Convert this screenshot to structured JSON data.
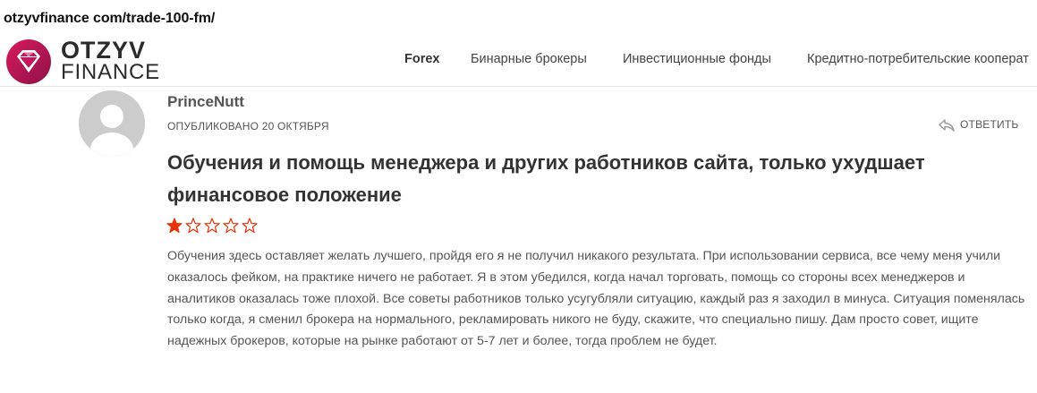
{
  "caption": {
    "url": "otzyvfinance com/trade-100-fm/"
  },
  "header": {
    "logo": {
      "line1": "OTZYV",
      "line2": "FINANCE",
      "mark": "diamond-logo-icon",
      "brand_color": "#c2185b"
    },
    "nav": [
      {
        "label": "Forex",
        "active": true
      },
      {
        "label": "Бинарные брокеры",
        "active": false
      },
      {
        "label": "Инвестиционные фонды",
        "active": false
      },
      {
        "label": "Кредитно-потребительские кооперат",
        "active": false
      }
    ]
  },
  "comment": {
    "avatar": "user-avatar-placeholder-icon",
    "author": "PrinceNutt",
    "published": "ОПУБЛИКОВАНО 20 ОКТЯБРЯ",
    "reply_label": "ОТВЕТИТЬ",
    "reply_icon": "reply-arrow-icon",
    "title": "Обучения и помощь менеджера и других работников сайта, только ухудшает финансовое положение",
    "rating": {
      "value": 1,
      "max": 5,
      "star_color": "#e8340c"
    },
    "body": "Обучения здесь оставляет желать лучшего, пройдя его я не получил никакого результата. При использовании сервиса, все чему меня учили оказалось фейком, на практике ничего не работает. Я в этом убедился, когда начал торговать, помощь со стороны всех менеджеров и аналитиков оказалась тоже плохой. Все советы работников только усугубляли ситуацию, каждый раз я заходил в минуса. Ситуация поменялась только когда, я сменил брокера на нормального, рекламировать никого не буду, скажите, что специально пишу. Дам просто совет, ищите надежных брокеров, которые на рынке работают от 5-7 лет и более, тогда проблем не будет."
  }
}
